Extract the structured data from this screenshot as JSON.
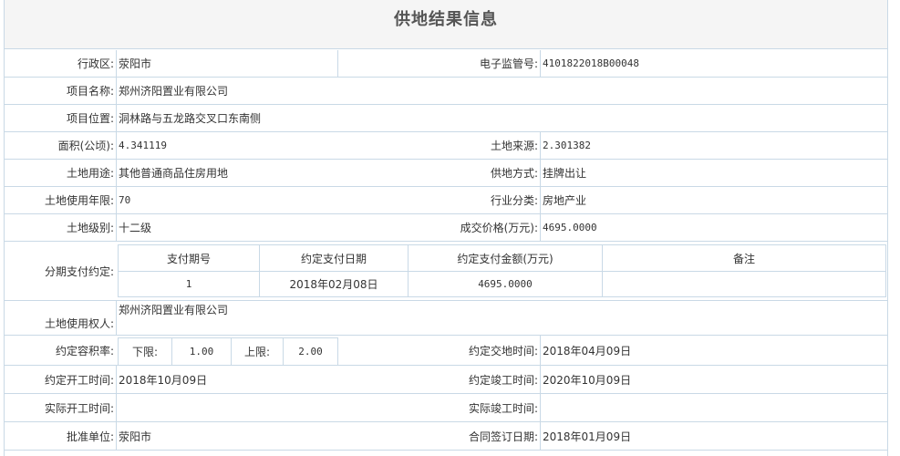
{
  "title": "供地结果信息",
  "fields": {
    "district_label": "行政区:",
    "district_value": "荥阳市",
    "supervision_no_label": "电子监管号:",
    "supervision_no_value": "4101822018B00048",
    "project_name_label": "项目名称:",
    "project_name_value": "郑州济阳置业有限公司",
    "project_location_label": "项目位置:",
    "project_location_value": "洞林路与五龙路交叉口东南侧",
    "area_label": "面积(公顷):",
    "area_value": "4.341119",
    "land_source_label": "土地来源:",
    "land_source_value": "2.301382",
    "land_use_label": "土地用途:",
    "land_use_value": "其他普通商品住房用地",
    "supply_method_label": "供地方式:",
    "supply_method_value": "挂牌出让",
    "use_years_label": "土地使用年限:",
    "use_years_value": "70",
    "industry_label": "行业分类:",
    "industry_value": "房地产业",
    "land_grade_label": "土地级别:",
    "land_grade_value": "十二级",
    "price_label": "成交价格(万元):",
    "price_value": "4695.0000",
    "installment_label": "分期支付约定:",
    "land_user_label": "土地使用权人:",
    "land_user_value": "郑州济阳置业有限公司",
    "far_label": "约定容积率:",
    "far_lower_label": "下限:",
    "far_lower_value": "1.00",
    "far_upper_label": "上限:",
    "far_upper_value": "2.00",
    "delivery_time_label": "约定交地时间:",
    "delivery_time_value": "2018年04月09日",
    "start_time_label": "约定开工时间:",
    "start_time_value": "2018年10月09日",
    "completion_time_label": "约定竣工时间:",
    "completion_time_value": "2020年10月09日",
    "actual_start_label": "实际开工时间:",
    "actual_start_value": "",
    "actual_completion_label": "实际竣工时间:",
    "actual_completion_value": "",
    "approval_unit_label": "批准单位:",
    "approval_unit_value": "荥阳市",
    "contract_date_label": "合同签订日期:",
    "contract_date_value": "2018年01月09日"
  },
  "installment_table": {
    "headers": [
      "支付期号",
      "约定支付日期",
      "约定支付金额(万元)",
      "备注"
    ],
    "rows": [
      [
        "1",
        "2018年02月08日",
        "4695.0000",
        ""
      ]
    ]
  }
}
